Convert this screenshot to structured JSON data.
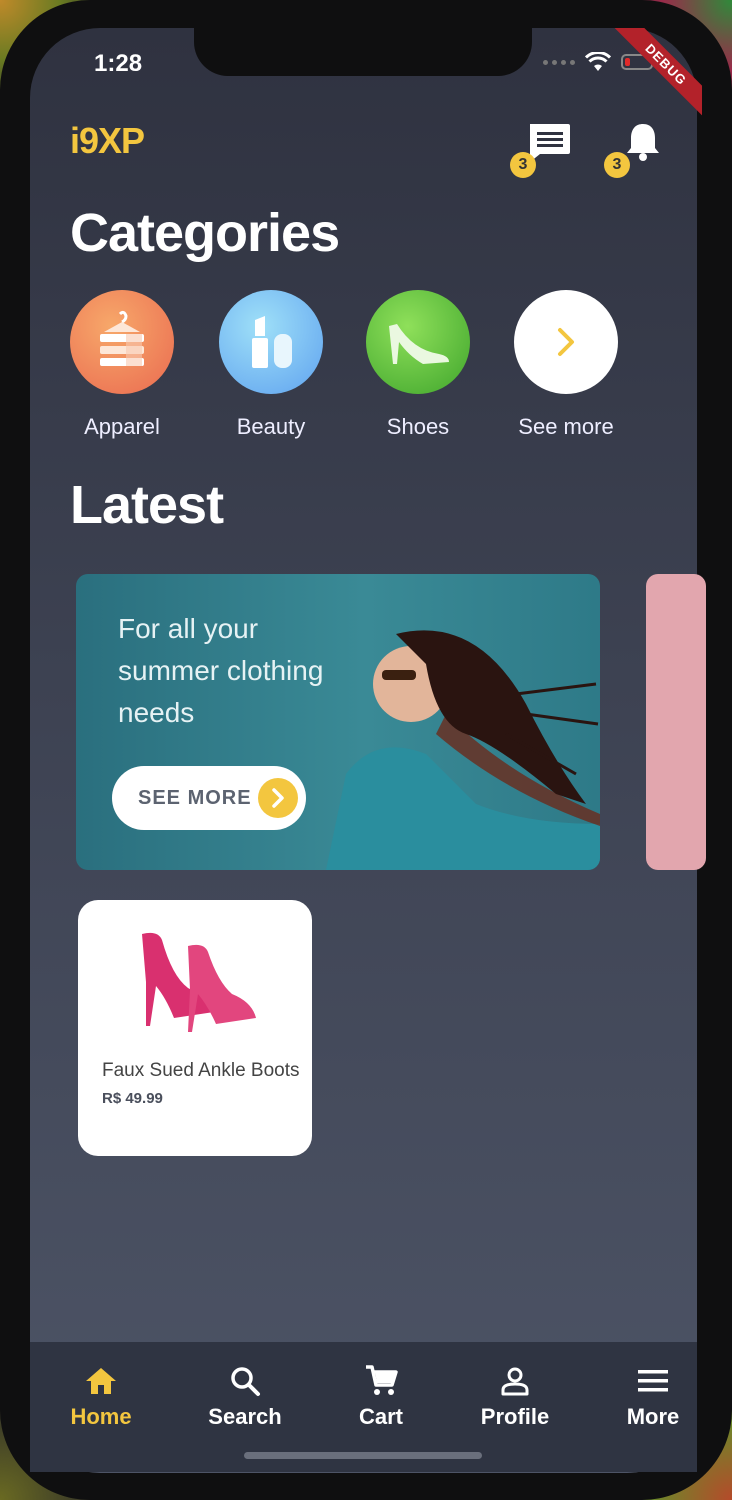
{
  "status": {
    "time": "1:28",
    "debug_label": "DEBUG"
  },
  "header": {
    "logo": "i9XP",
    "messages_badge": "3",
    "notifications_badge": "3"
  },
  "categories": {
    "title": "Categories",
    "items": [
      {
        "label": "Apparel",
        "icon": "apparel-icon",
        "color": "#ef7a5c"
      },
      {
        "label": "Beauty",
        "icon": "lipstick-icon",
        "color": "#6fb9f3"
      },
      {
        "label": "Shoes",
        "icon": "high-heel-icon",
        "color": "#5bbf3a"
      },
      {
        "label": "See more",
        "icon": "chevron-right-icon",
        "color": "#ffffff"
      }
    ]
  },
  "latest": {
    "title": "Latest",
    "banner": {
      "text": "For all your summer clothing needs",
      "button_label": "SEE MORE"
    },
    "products": [
      {
        "name": "Faux Sued Ankle Boots",
        "price": "R$ 49.99"
      }
    ]
  },
  "tabbar": {
    "items": [
      {
        "label": "Home",
        "icon": "home-icon",
        "active": true
      },
      {
        "label": "Search",
        "icon": "search-icon",
        "active": false
      },
      {
        "label": "Cart",
        "icon": "cart-icon",
        "active": false
      },
      {
        "label": "Profile",
        "icon": "profile-icon",
        "active": false
      },
      {
        "label": "More",
        "icon": "menu-icon",
        "active": false
      }
    ]
  },
  "colors": {
    "accent": "#f3c63f",
    "background": "#3d4252",
    "tabbar": "#2f3442"
  }
}
